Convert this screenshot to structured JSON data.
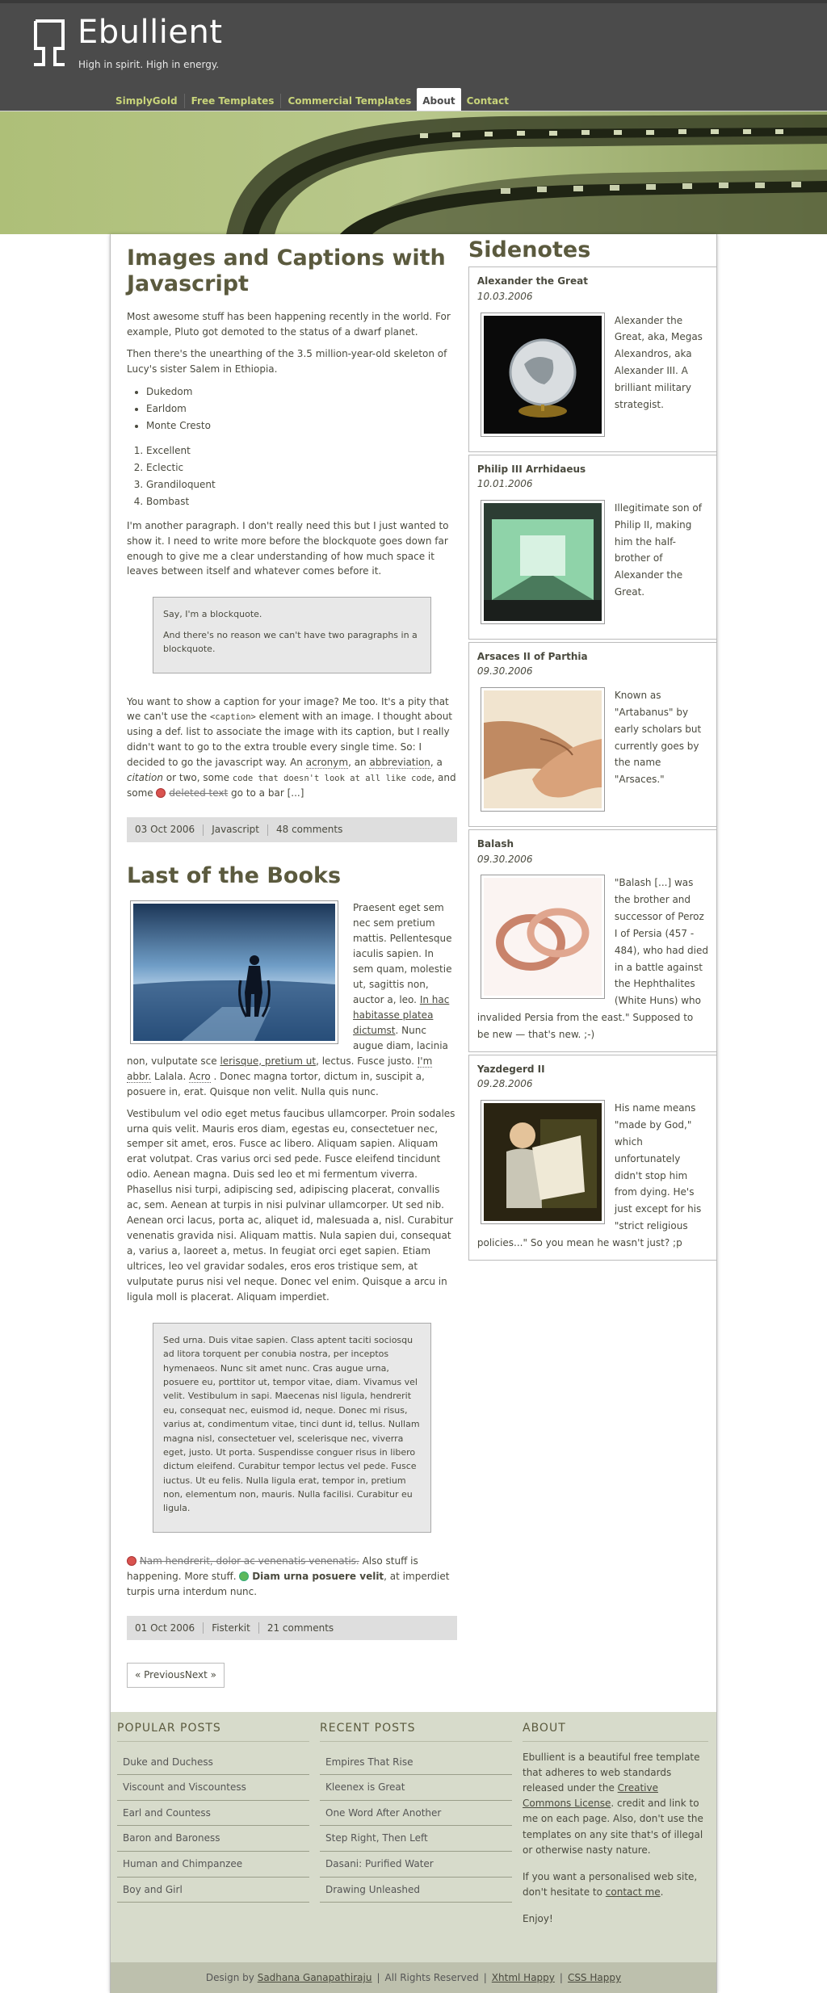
{
  "site": {
    "title": "Ebullient",
    "tagline": "High in spirit. High in energy."
  },
  "nav": {
    "items": [
      {
        "label": "SimplyGold"
      },
      {
        "label": "Free Templates"
      },
      {
        "label": "Commercial Templates"
      },
      {
        "label": "About",
        "active": true
      },
      {
        "label": "Contact"
      }
    ]
  },
  "post1": {
    "title": "Images and Captions with Javascript",
    "p1": "Most awesome stuff has been happening recently in the world. For example, Pluto got demoted to the status of a dwarf planet.",
    "p2": "Then there's the unearthing of the 3.5 million-year-old skeleton of Lucy's sister Salem in Ethiopia.",
    "ul": [
      "Dukedom",
      "Earldom",
      "Monte Cresto"
    ],
    "ol": [
      "Excellent",
      "Eclectic",
      "Grandiloquent",
      "Bombast"
    ],
    "p3": "I'm another paragraph. I don't really need this but I just wanted to show it. I need to write more before the blockquote goes down far enough to give me a clear understanding of how much space it leaves between itself and whatever comes before it.",
    "bq1": "Say, I'm a blockquote.",
    "bq2": "And there's no reason we can't have two paragraphs in a blockquote.",
    "p4a": "You want to show a caption for your image? Me too. It's a pity that we can't use the ",
    "p4code": "<caption>",
    "p4b": " element with an image. I thought about using a def. list to associate the image with its caption, but I really didn't want to go to the extra trouble every single time. So: I decided to go the javascript way. An ",
    "acronym": "acronym",
    "p4c": ", an ",
    "abbreviation": "abbreviation",
    "p4d": ", a ",
    "citation": "citation",
    "p4e": " or two, some ",
    "code2": "code that doesn't look at all like code",
    "p4f": ", and some ",
    "deleted": "deleted text",
    "p4g": " go to a bar [...]",
    "date": "03 Oct 2006",
    "category": "Javascript",
    "comments": "48 comments"
  },
  "post2": {
    "title": "Last of the Books",
    "p1a": "Praesent eget sem nec sem pretium mattis. Pellentesque iaculis sapien. In sem quam, molestie ut, sagittis non, auctor a, leo. ",
    "link1": "In hac habitasse platea dictumst",
    "p1b": ". Nunc augue diam, lacinia non, vulputate sce ",
    "link2": "lerisque, pretium ut",
    "p1c": ", lectus. Fusce justo. ",
    "abbr": "I'm abbr.",
    "p1d": " Lalala. ",
    "acro": "Acro",
    "p1e": " . Donec magna tortor, dictum in, suscipit a, posuere in, erat. Quisque non velit. Nulla quis nunc.",
    "p2": "Vestibulum vel odio eget metus faucibus ullamcorper. Proin sodales urna quis velit. Mauris eros diam, egestas eu, consectetuer nec, semper sit amet, eros. Fusce ac libero. Aliquam sapien. Aliquam erat volutpat. Cras varius orci sed pede. Fusce eleifend tincidunt odio. Aenean magna. Duis sed leo et mi fermentum viverra. Phasellus nisi turpi, adipiscing sed, adipiscing placerat, convallis ac, sem. Aenean at turpis in nisi pulvinar ullamcorper. Ut sed nib. Aenean orci lacus, porta ac, aliquet id, malesuada a, nisl. Curabitur venenatis gravida nisi. Aliquam mattis. Nula sapien dui, consequat a, varius a, laoreet a, metus. In feugiat orci eget sapien. Etiam ultrices, leo vel gravidar sodales, eros eros tristique sem, at vulputate purus nisi vel neque. Donec vel enim. Quisque a arcu in ligula moll is placerat. Aliquam imperdiet.",
    "bq": "Sed urna. Duis vitae sapien. Class aptent taciti sociosqu ad litora torquent per conubia nostra, per inceptos hymenaeos. Nunc sit amet nunc. Cras augue urna, posuere eu, porttitor ut, tempor vitae, diam. Vivamus vel velit. Vestibulum in sapi. Maecenas nisl ligula, hendrerit eu, consequat nec, euismod id, neque. Donec mi risus, varius at, condimentum vitae, tinci dunt id, tellus. Nullam magna nisl, consectetuer vel, scelerisque nec, viverra eget, justo. Ut porta. Suspendisse conguer risus in libero dictum eleifend. Curabitur tempor lectus vel pede. Fusce iuctus. Ut eu felis. Nulla ligula erat, tempor in, pretium non, elementum non, mauris. Nulla facilisi. Curabitur eu ligula.",
    "p3del": "Nam hendrerit, dolor ac venenatis venenatis.",
    "p3a": " Also stuff is happening. More stuff. ",
    "p3strong": "Diam urna posuere velit",
    "p3b": ", at imperdiet turpis urna interdum nunc.",
    "date": "01 Oct 2006",
    "category": "Fisterkit",
    "comments": "21 comments"
  },
  "pager": {
    "prev": "« Previous",
    "next": "Next »"
  },
  "sidenotes": {
    "title": "Sidenotes",
    "items": [
      {
        "name": "Alexander the Great",
        "date": "10.03.2006",
        "text": "Alexander the Great, aka, Megas Alexandros, aka Alexander III. A brilliant military strategist."
      },
      {
        "name": "Philip III Arrhidaeus",
        "date": "10.01.2006",
        "text": "Illegitimate son of Philip II, making him the half-brother of Alexander the Great."
      },
      {
        "name": "Arsaces II of Parthia",
        "date": "09.30.2006",
        "text": "Known as \"Artabanus\" by early scholars but currently goes by the name \"Arsaces.\""
      },
      {
        "name": "Balash",
        "date": "09.30.2006",
        "text": "\"Balash [...] was the brother and successor of Peroz I of Persia (457 - 484), who had died in a battle against the Hephthalites (White Huns) who invalided Persia from the east.\" Supposed to be new — that's new. ;-)"
      },
      {
        "name": "Yazdegerd II",
        "date": "09.28.2006",
        "text": "His name means \"made by God,\" which unfortunately didn't stop him from dying. He's just except for his \"strict religious policies...\" So you mean he wasn't just? ;p"
      }
    ]
  },
  "footer": {
    "popular_title": "POPULAR POSTS",
    "popular": [
      "Duke and Duchess",
      "Viscount and Viscountess",
      "Earl and Countess",
      "Baron and Baroness",
      "Human and Chimpanzee",
      "Boy and Girl"
    ],
    "recent_title": "RECENT POSTS",
    "recent": [
      "Empires That Rise",
      "Kleenex is Great",
      "One Word After Another",
      "Step Right, Then Left",
      "Dasani: Purified Water",
      "Drawing Unleashed"
    ],
    "about_title": "ABOUT",
    "about_p1a": "Ebullient is a beautiful free template that adheres to web standards released under the ",
    "about_link": "Creative Commons License",
    "about_p1b": ". credit and link to me on each page. Also, don't use the templates on any site that's of illegal or otherwise nasty nature.",
    "about_p2a": "If you want a personalised web site, don't hesitate to ",
    "about_contact": "contact me",
    "about_p2b": ".",
    "about_p3": "Enjoy!"
  },
  "bottom": {
    "design_by": "Design by ",
    "author": "Sadhana Ganapathiraju",
    "rights": "All Rights Reserved",
    "xhtml": "Xhtml Happy",
    "css": "CSS Happy"
  },
  "colors": {
    "header_bg": "#4b4b4b",
    "nav_link": "#c8d47a",
    "hero_tint": "#c4d1a0",
    "title": "#5b5a3e",
    "footer_bg": "#d7dbcb"
  }
}
